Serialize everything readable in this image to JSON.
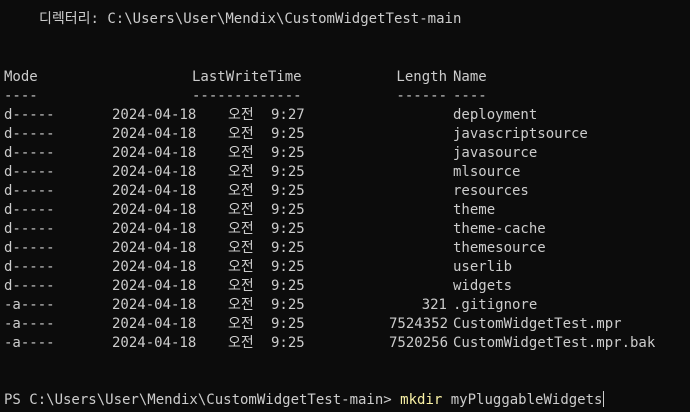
{
  "directory_line": "디렉터리: C:\\Users\\User\\Mendix\\CustomWidgetTest-main",
  "headers": {
    "mode": "Mode",
    "last_write_time": "LastWriteTime",
    "length": "Length",
    "name": "Name"
  },
  "underlines": {
    "mode": "----",
    "last_write_time": "-------------",
    "length": "------",
    "name": "----"
  },
  "rows": [
    {
      "mode": "d-----",
      "date": "2024-04-18",
      "ampm": "오전",
      "time": "9:27",
      "length": "",
      "name": "deployment"
    },
    {
      "mode": "d-----",
      "date": "2024-04-18",
      "ampm": "오전",
      "time": "9:25",
      "length": "",
      "name": "javascriptsource"
    },
    {
      "mode": "d-----",
      "date": "2024-04-18",
      "ampm": "오전",
      "time": "9:25",
      "length": "",
      "name": "javasource"
    },
    {
      "mode": "d-----",
      "date": "2024-04-18",
      "ampm": "오전",
      "time": "9:25",
      "length": "",
      "name": "mlsource"
    },
    {
      "mode": "d-----",
      "date": "2024-04-18",
      "ampm": "오전",
      "time": "9:25",
      "length": "",
      "name": "resources"
    },
    {
      "mode": "d-----",
      "date": "2024-04-18",
      "ampm": "오전",
      "time": "9:25",
      "length": "",
      "name": "theme"
    },
    {
      "mode": "d-----",
      "date": "2024-04-18",
      "ampm": "오전",
      "time": "9:25",
      "length": "",
      "name": "theme-cache"
    },
    {
      "mode": "d-----",
      "date": "2024-04-18",
      "ampm": "오전",
      "time": "9:25",
      "length": "",
      "name": "themesource"
    },
    {
      "mode": "d-----",
      "date": "2024-04-18",
      "ampm": "오전",
      "time": "9:25",
      "length": "",
      "name": "userlib"
    },
    {
      "mode": "d-----",
      "date": "2024-04-18",
      "ampm": "오전",
      "time": "9:25",
      "length": "",
      "name": "widgets"
    },
    {
      "mode": "-a----",
      "date": "2024-04-18",
      "ampm": "오전",
      "time": "9:25",
      "length": "321",
      "name": ".gitignore"
    },
    {
      "mode": "-a----",
      "date": "2024-04-18",
      "ampm": "오전",
      "time": "9:25",
      "length": "7524352",
      "name": "CustomWidgetTest.mpr"
    },
    {
      "mode": "-a----",
      "date": "2024-04-18",
      "ampm": "오전",
      "time": "9:25",
      "length": "7520256",
      "name": "CustomWidgetTest.mpr.bak"
    }
  ],
  "prompt": {
    "text": "PS C:\\Users\\User\\Mendix\\CustomWidgetTest-main> ",
    "command": "mkdir",
    "argument": " myPluggableWidgets"
  },
  "colors": {
    "background": "#0c0c0c",
    "foreground": "#cccccc",
    "command": "#f9f1a5"
  }
}
